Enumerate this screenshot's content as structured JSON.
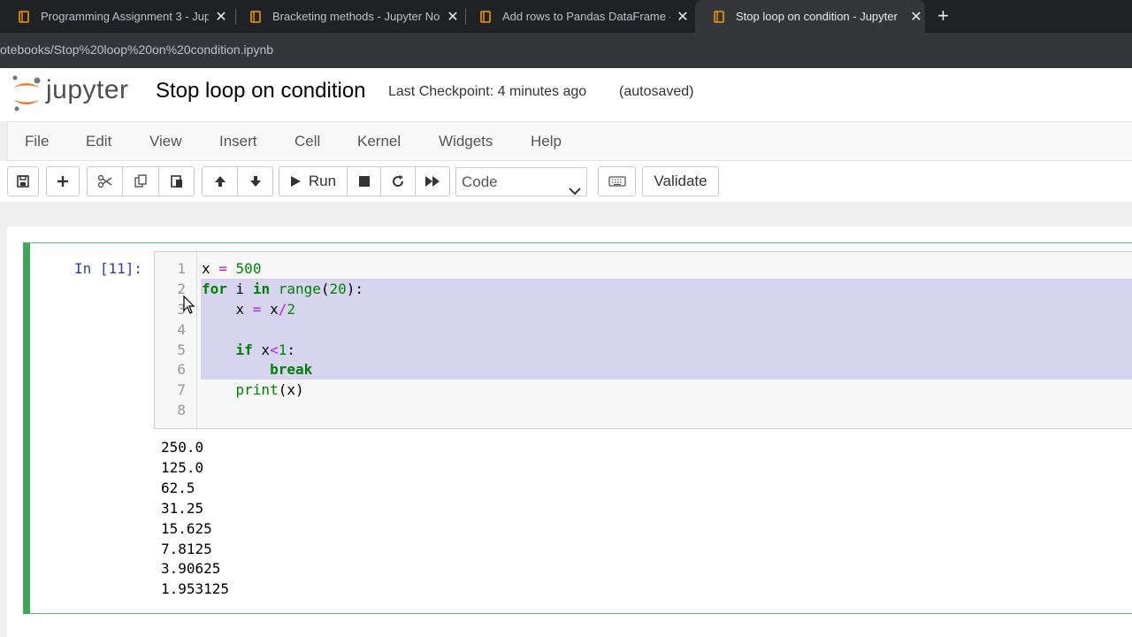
{
  "browser": {
    "tabs": [
      {
        "title": "Programming Assignment 3 - Jup",
        "active": false
      },
      {
        "title": "Bracketing methods - Jupyter No",
        "active": false
      },
      {
        "title": "Add rows to Pandas DataFrame -",
        "active": false
      },
      {
        "title": "Stop loop on condition - Jupyter",
        "active": true
      }
    ],
    "new_tab": "+",
    "close_glyph": "✕",
    "address": "otebooks/Stop%20loop%20on%20condition.ipynb"
  },
  "header": {
    "logo_text": "jupyter",
    "notebook_name": "Stop loop on condition",
    "checkpoint": "Last Checkpoint: 4 minutes ago",
    "autosave": "(autosaved)"
  },
  "menubar": [
    "File",
    "Edit",
    "View",
    "Insert",
    "Cell",
    "Kernel",
    "Widgets",
    "Help"
  ],
  "toolbar": {
    "run_label": "Run",
    "cell_type": "Code",
    "validate_label": "Validate"
  },
  "cell": {
    "prompt": "In [11]:",
    "line_numbers": [
      "1",
      "2",
      "3",
      "4",
      "5",
      "6",
      "7",
      "8"
    ],
    "code": [
      "x = 500",
      "for i in range(20):",
      "    x = x/2",
      "",
      "    if x<1:",
      "        break",
      "    print(x)",
      ""
    ],
    "output": [
      "250.0",
      "125.0",
      "62.5",
      "31.25",
      "15.625",
      "7.8125",
      "3.90625",
      "1.953125"
    ]
  },
  "colors": {
    "tab_bar": "#202124",
    "active_tab": "#35363a",
    "cell_border": "#42a55c",
    "selection": "#d7d4f0",
    "prompt": "#303f9f",
    "keyword": "#008000"
  }
}
